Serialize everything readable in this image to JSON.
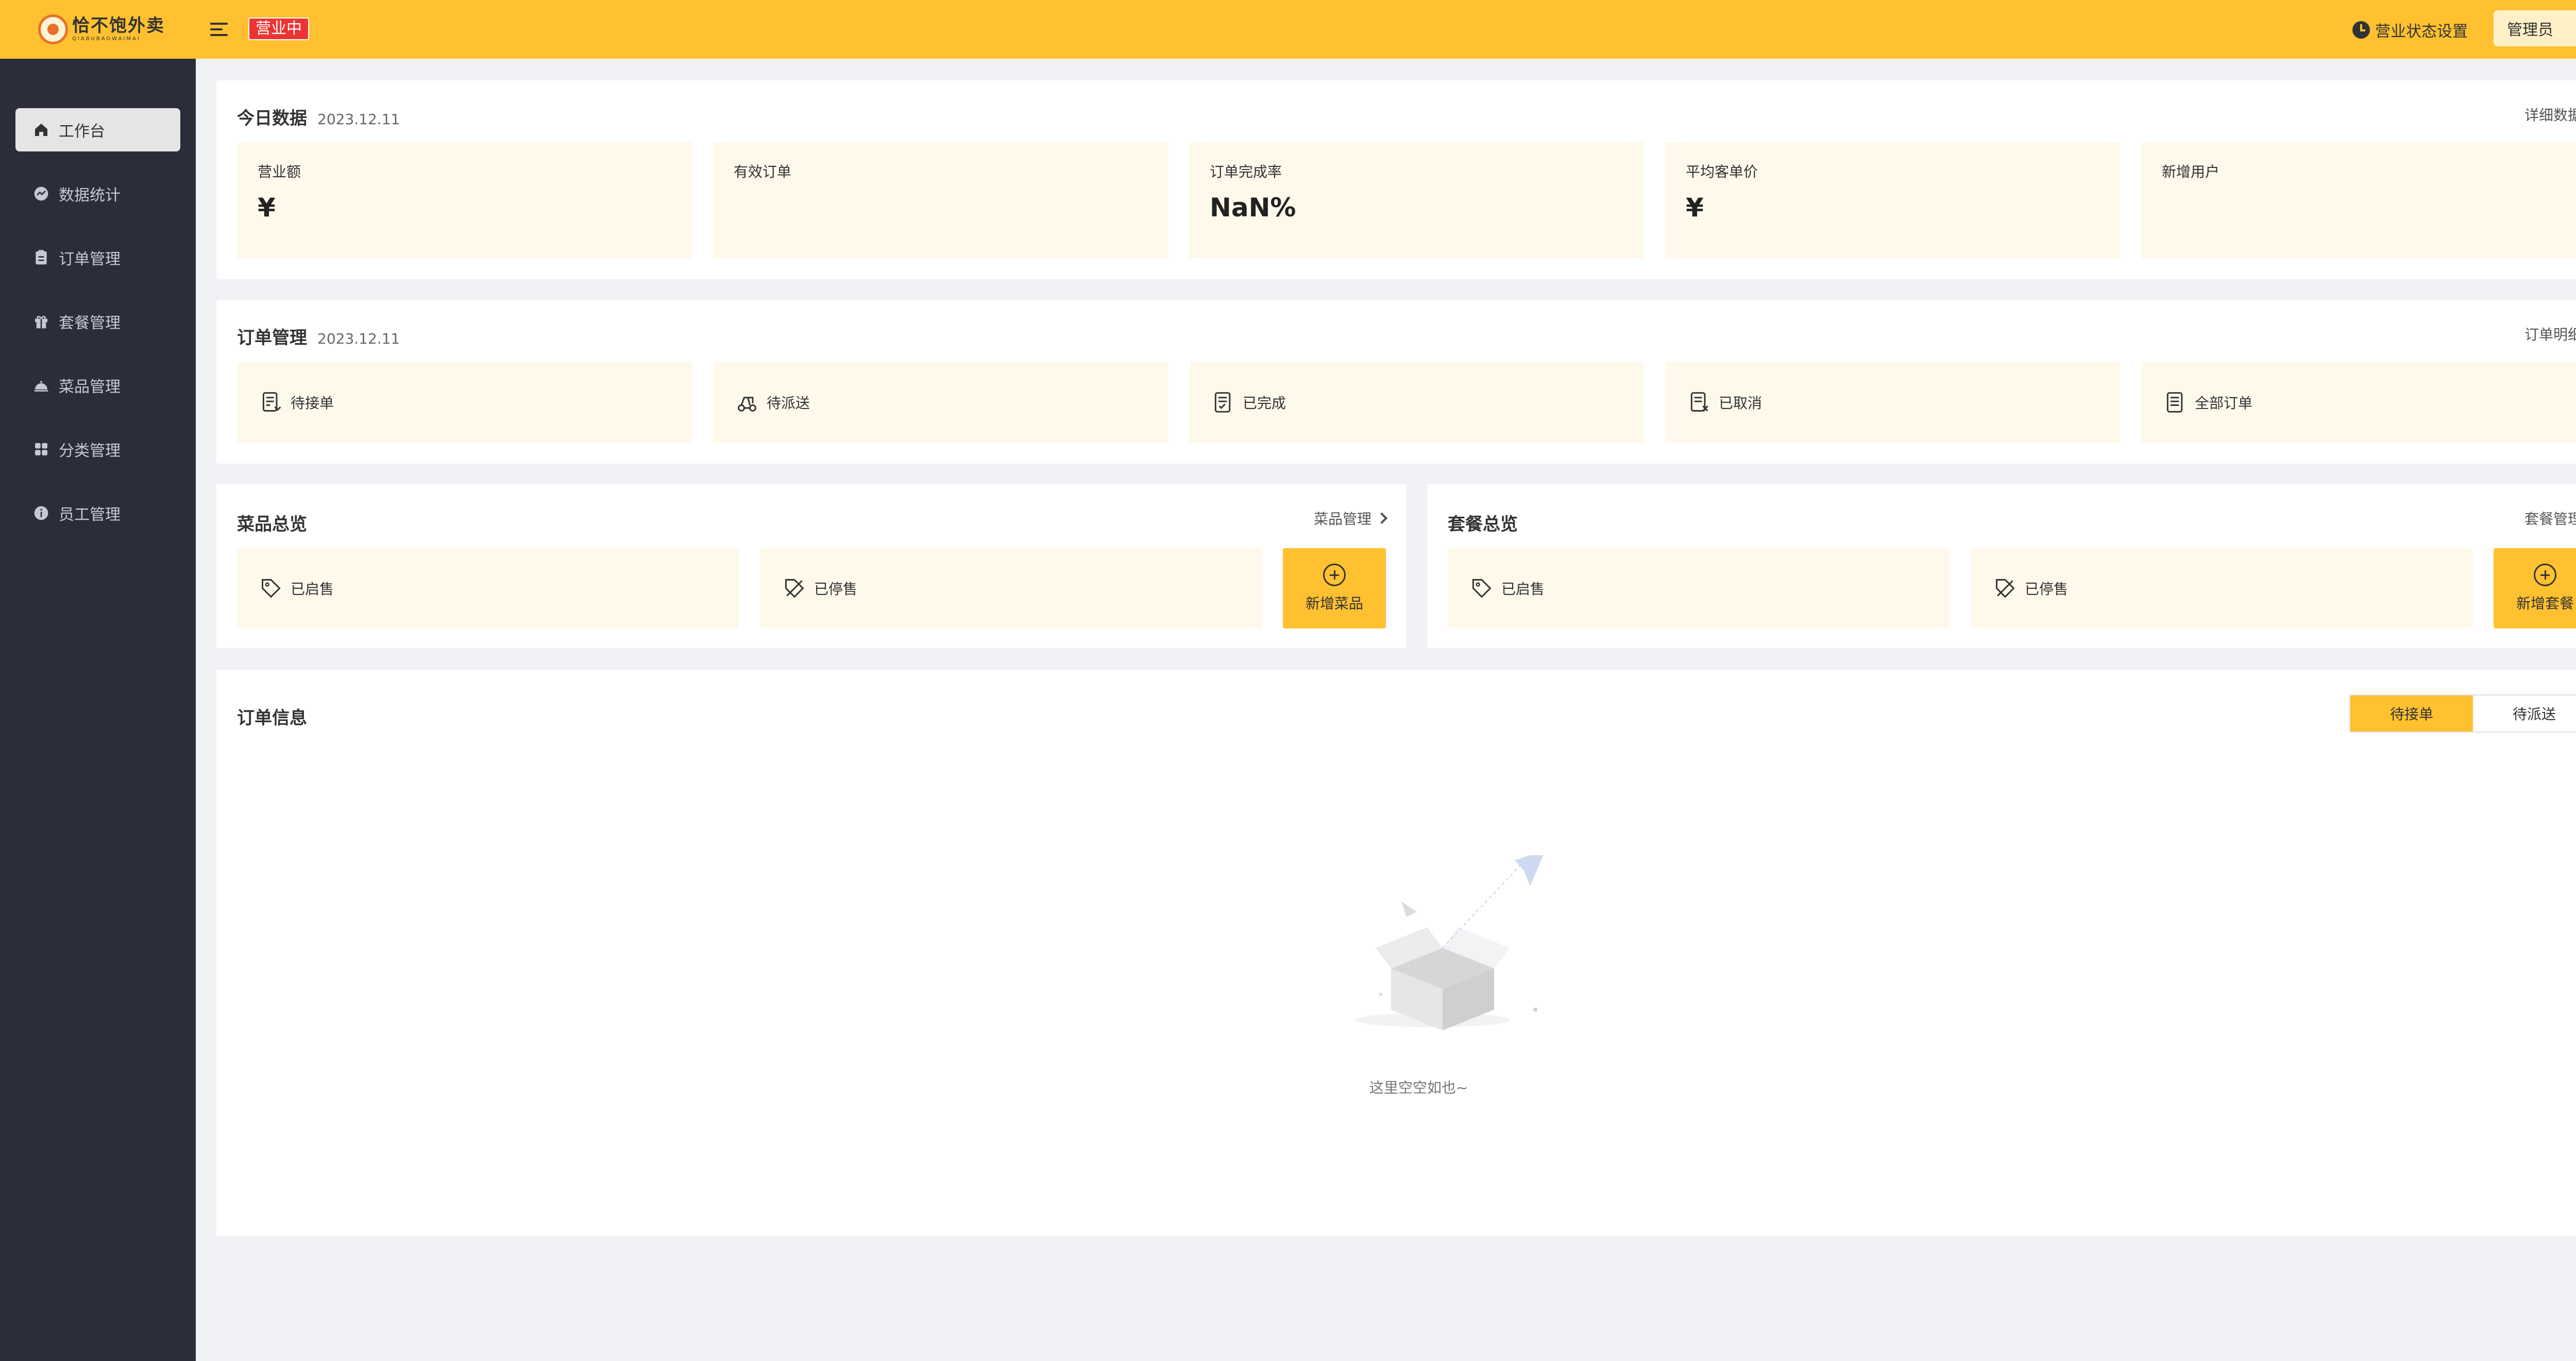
{
  "header": {
    "logo_cn": "恰不饱外卖",
    "logo_en": "QIABUBAOWAIMAI",
    "status_badge": "营业中",
    "status_setting": "营业状态设置",
    "admin": "管理员"
  },
  "sidebar": {
    "items": [
      {
        "label": "工作台",
        "icon": "home-icon"
      },
      {
        "label": "数据统计",
        "icon": "chart-icon"
      },
      {
        "label": "订单管理",
        "icon": "clipboard-icon"
      },
      {
        "label": "套餐管理",
        "icon": "gift-icon"
      },
      {
        "label": "菜品管理",
        "icon": "dish-icon"
      },
      {
        "label": "分类管理",
        "icon": "grid-icon"
      },
      {
        "label": "员工管理",
        "icon": "info-icon"
      }
    ]
  },
  "today": {
    "title": "今日数据",
    "date": "2023.12.11",
    "link": "详细数据",
    "tiles": [
      {
        "label": "营业额",
        "value": "¥"
      },
      {
        "label": "有效订单",
        "value": ""
      },
      {
        "label": "订单完成率",
        "value": "NaN%"
      },
      {
        "label": "平均客单价",
        "value": "¥"
      },
      {
        "label": "新增用户",
        "value": ""
      }
    ]
  },
  "orders": {
    "title": "订单管理",
    "date": "2023.12.11",
    "link": "订单明细",
    "tiles": [
      {
        "label": "待接单",
        "icon": "order-pending-icon"
      },
      {
        "label": "待派送",
        "icon": "delivery-icon"
      },
      {
        "label": "已完成",
        "icon": "order-done-icon"
      },
      {
        "label": "已取消",
        "icon": "order-cancel-icon"
      },
      {
        "label": "全部订单",
        "icon": "order-all-icon"
      }
    ]
  },
  "dishes": {
    "title": "菜品总览",
    "link": "菜品管理",
    "on_sale": "已启售",
    "off_sale": "已停售",
    "add": "新增菜品"
  },
  "combos": {
    "title": "套餐总览",
    "link": "套餐管理",
    "on_sale": "已启售",
    "off_sale": "已停售",
    "add": "新增套餐"
  },
  "order_info": {
    "title": "订单信息",
    "tabs": [
      "待接单",
      "待派送"
    ],
    "empty": "这里空空如也~"
  },
  "colors": {
    "accent": "#ffc130",
    "sidebar": "#2b2d3a",
    "tile": "#fff9ec"
  }
}
